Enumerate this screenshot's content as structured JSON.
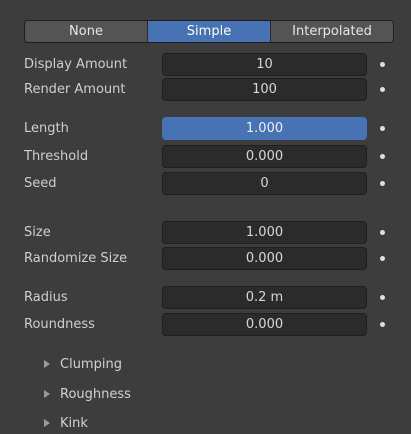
{
  "mode_tabs": [
    {
      "label": "None",
      "active": false
    },
    {
      "label": "Simple",
      "active": true
    },
    {
      "label": "Interpolated",
      "active": false
    }
  ],
  "properties": [
    {
      "label": "Display Amount",
      "value": "10"
    },
    {
      "label": "Render Amount",
      "value": "100"
    },
    {
      "label": "Length",
      "value": "1.000",
      "active": true
    },
    {
      "label": "Threshold",
      "value": "0.000"
    },
    {
      "label": "Seed",
      "value": "0"
    },
    {
      "label": "Size",
      "value": "1.000"
    },
    {
      "label": "Randomize Size",
      "value": "0.000"
    },
    {
      "label": "Radius",
      "value": "0.2 m"
    },
    {
      "label": "Roundness",
      "value": "0.000"
    }
  ],
  "subpanels": [
    {
      "label": "Clumping",
      "icon": "triangle-right-icon"
    },
    {
      "label": "Roughness",
      "icon": "triangle-right-icon"
    },
    {
      "label": "Kink",
      "icon": "triangle-right-icon"
    }
  ],
  "colors": {
    "background": "#3d3d3d",
    "field": "#2b2b2b",
    "accent": "#4772b3",
    "tab": "#545454"
  }
}
